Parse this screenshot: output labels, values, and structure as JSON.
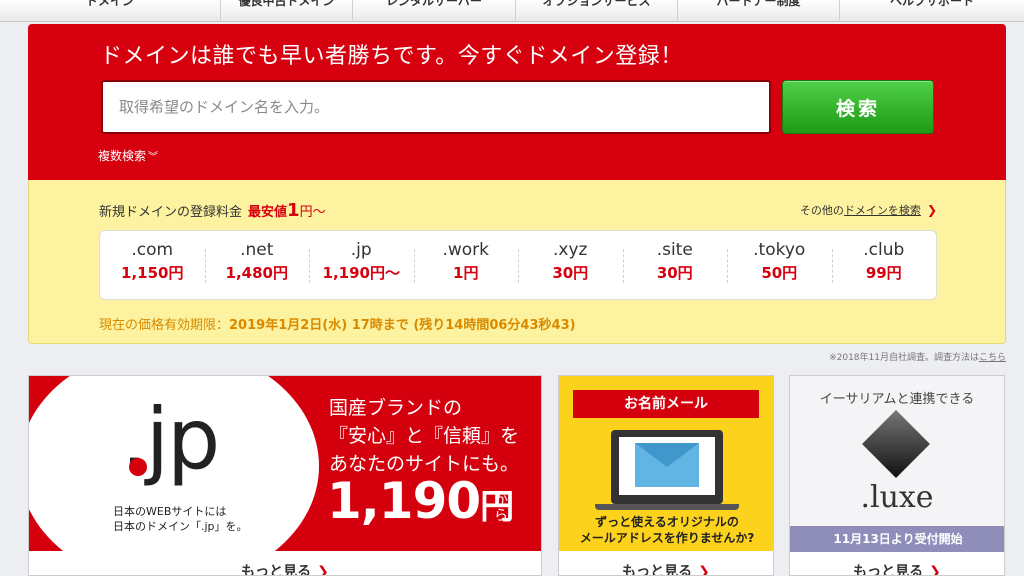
{
  "nav": {
    "items": [
      "ドメイン",
      "優良中古ドメイン",
      "レンタルサーバー",
      "オプションサービス",
      "パートナー制度",
      "ヘルプサポート"
    ]
  },
  "search": {
    "headline": "ドメインは誰でも早い者勝ちです。今すぐドメイン登録！",
    "placeholder": "取得希望のドメイン名を入力。",
    "button_label": "検索",
    "multi_label": "複数検索"
  },
  "pricing": {
    "title": "新規ドメインの登録料金",
    "lowest_label": "最安値",
    "lowest_value": "1",
    "lowest_unit": "円～",
    "other_prefix": "その他の",
    "other_link": "ドメインを検索",
    "tlds": [
      {
        "name": ".com",
        "price": "1,150円"
      },
      {
        "name": ".net",
        "price": "1,480円"
      },
      {
        "name": ".jp",
        "price": "1,190円～"
      },
      {
        "name": ".work",
        "price": "1円"
      },
      {
        "name": ".xyz",
        "price": "30円"
      },
      {
        "name": ".site",
        "price": "30円"
      },
      {
        "name": ".tokyo",
        "price": "50円"
      },
      {
        "name": ".club",
        "price": "99円"
      }
    ],
    "validity_label": "現在の価格有効期限：",
    "validity_value": "2019年1月2日(水) 17時まで (残り14時間06分43秒43)"
  },
  "note": {
    "text": "※2018年11月自社調査。調査方法は",
    "link": "こちら"
  },
  "banners": {
    "jp": {
      "logo": ".jp",
      "caption_line1": "日本のWEBサイトには",
      "caption_line2": "日本のドメイン「.jp」を。",
      "copy_line1": "国産ブランドの",
      "copy_line2": "『安心』と『信頼』を",
      "copy_line3": "あなたのサイトにも。",
      "price": "1,190",
      "yen": "円",
      "kara": "から",
      "more": "もっと見る"
    },
    "mail": {
      "ribbon": "お名前メール",
      "copy_line1": "ずっと使えるオリジナルの",
      "copy_line2": "メールアドレスを作りませんか?",
      "more": "もっと見る"
    },
    "luxe": {
      "title": "イーサリアムと連携できる",
      "logo": ".luxe",
      "bar": "11月13日より受付開始",
      "more": "もっと見る"
    }
  },
  "colors": {
    "brand_red": "#d6000f",
    "price_bg": "#fdf29f",
    "search_green": "#2bb323"
  }
}
